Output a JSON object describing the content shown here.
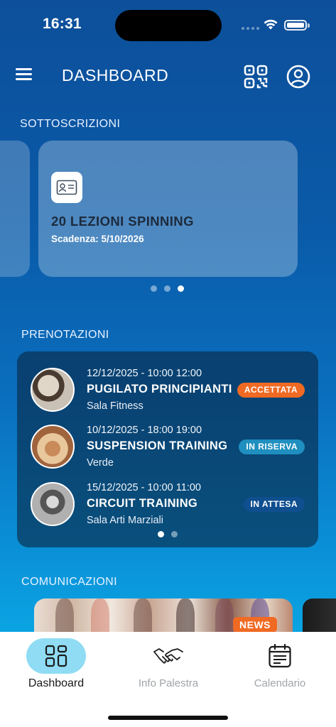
{
  "status_bar": {
    "time": "16:31"
  },
  "header": {
    "title": "DASHBOARD"
  },
  "subscriptions": {
    "title": "SOTTOSCRIZIONI",
    "items": [
      {
        "name": "20 LEZIONI SPINNING",
        "expiry": "Scadenza: 5/10/2026"
      }
    ],
    "page_count": 3,
    "active_page": 3
  },
  "bookings": {
    "title": "PRENOTAZIONI",
    "items": [
      {
        "datetime": "12/12/2025 - 10:00 12:00",
        "name": "PUGILATO PRINCIPIANTI",
        "room": "Sala Fitness",
        "status": "ACCETTATA",
        "status_color": "#f06a23"
      },
      {
        "datetime": "10/12/2025 - 18:00 19:00",
        "name": "SUSPENSION TRAINING",
        "room": "Verde",
        "status": "IN RISERVA",
        "status_color": "#1f8fc0"
      },
      {
        "datetime": "15/12/2025 - 10:00 11:00",
        "name": "CIRCUIT TRAINING",
        "room": "Sala Arti Marziali",
        "status": "IN ATTESA",
        "status_color": "#0f4f8f"
      }
    ],
    "page_count": 2,
    "active_page": 1
  },
  "communications": {
    "title": "COMUNICAZIONI",
    "news_badge": "NEWS"
  },
  "tabbar": {
    "dashboard": "Dashboard",
    "info": "Info Palestra",
    "calendar": "Calendario"
  }
}
